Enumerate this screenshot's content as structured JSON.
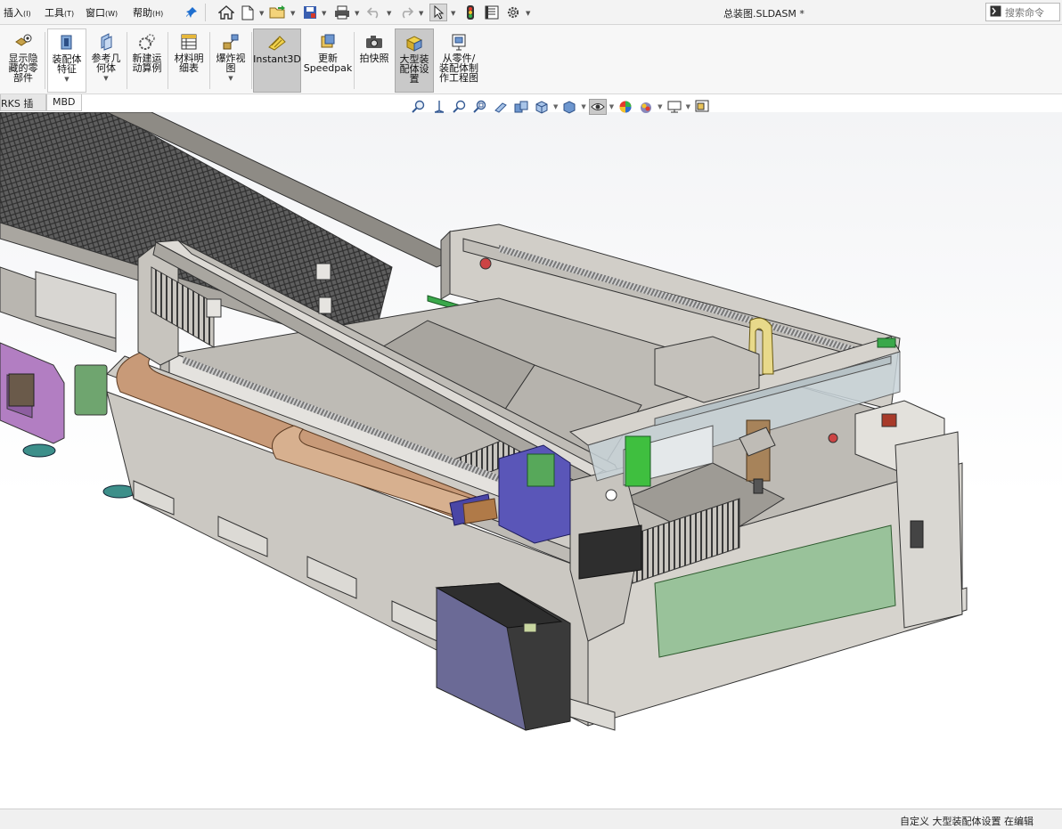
{
  "menu": {
    "items": [
      {
        "label": "插入",
        "key": "(I)"
      },
      {
        "label": "工具",
        "key": "(T)"
      },
      {
        "label": "窗口",
        "key": "(W)"
      },
      {
        "label": "帮助",
        "key": "(H)"
      }
    ]
  },
  "document": {
    "title": "总装图.SLDASM *"
  },
  "search": {
    "placeholder": "搜索命令"
  },
  "commands": [
    {
      "label": "显示隐藏的零部件",
      "lines": [
        "显示隐",
        "藏的零",
        "部件"
      ],
      "icon": "show-hidden-icon"
    },
    {
      "label": "装配体特征",
      "lines": [
        "装配体",
        "特征"
      ],
      "icon": "assembly-feature-icon",
      "dropdown": true
    },
    {
      "label": "参考几何体",
      "lines": [
        "参考几",
        "何体"
      ],
      "icon": "reference-geometry-icon",
      "dropdown": true
    },
    {
      "label": "新建运动算例",
      "lines": [
        "新建运",
        "动算例"
      ],
      "icon": "motion-study-icon"
    },
    {
      "label": "材料明细表",
      "lines": [
        "材料明",
        "细表"
      ],
      "icon": "bom-icon"
    },
    {
      "label": "爆炸视图",
      "lines": [
        "爆炸视",
        "图"
      ],
      "icon": "explode-view-icon",
      "dropdown": true
    },
    {
      "label": "Instant3D",
      "lines": [
        "Instant3D"
      ],
      "icon": "instant3d-icon",
      "active": true
    },
    {
      "label": "更新Speedpak",
      "lines": [
        "更新",
        "Speedpak"
      ],
      "icon": "speedpak-icon"
    },
    {
      "label": "拍快照",
      "lines": [
        "拍快照"
      ],
      "icon": "snapshot-icon"
    },
    {
      "label": "大型装配体设置",
      "lines": [
        "大型装",
        "配体设",
        "置"
      ],
      "icon": "large-assembly-icon",
      "active": true
    },
    {
      "label": "从零件/装配体制作工程图",
      "lines": [
        "从零件/",
        "装配体制",
        "作工程图"
      ],
      "icon": "make-drawing-icon"
    }
  ],
  "tabs": [
    {
      "label": "RKS 插件"
    },
    {
      "label": "MBD"
    }
  ],
  "status": {
    "text": "自定义   大型装配体设置   在编辑"
  }
}
